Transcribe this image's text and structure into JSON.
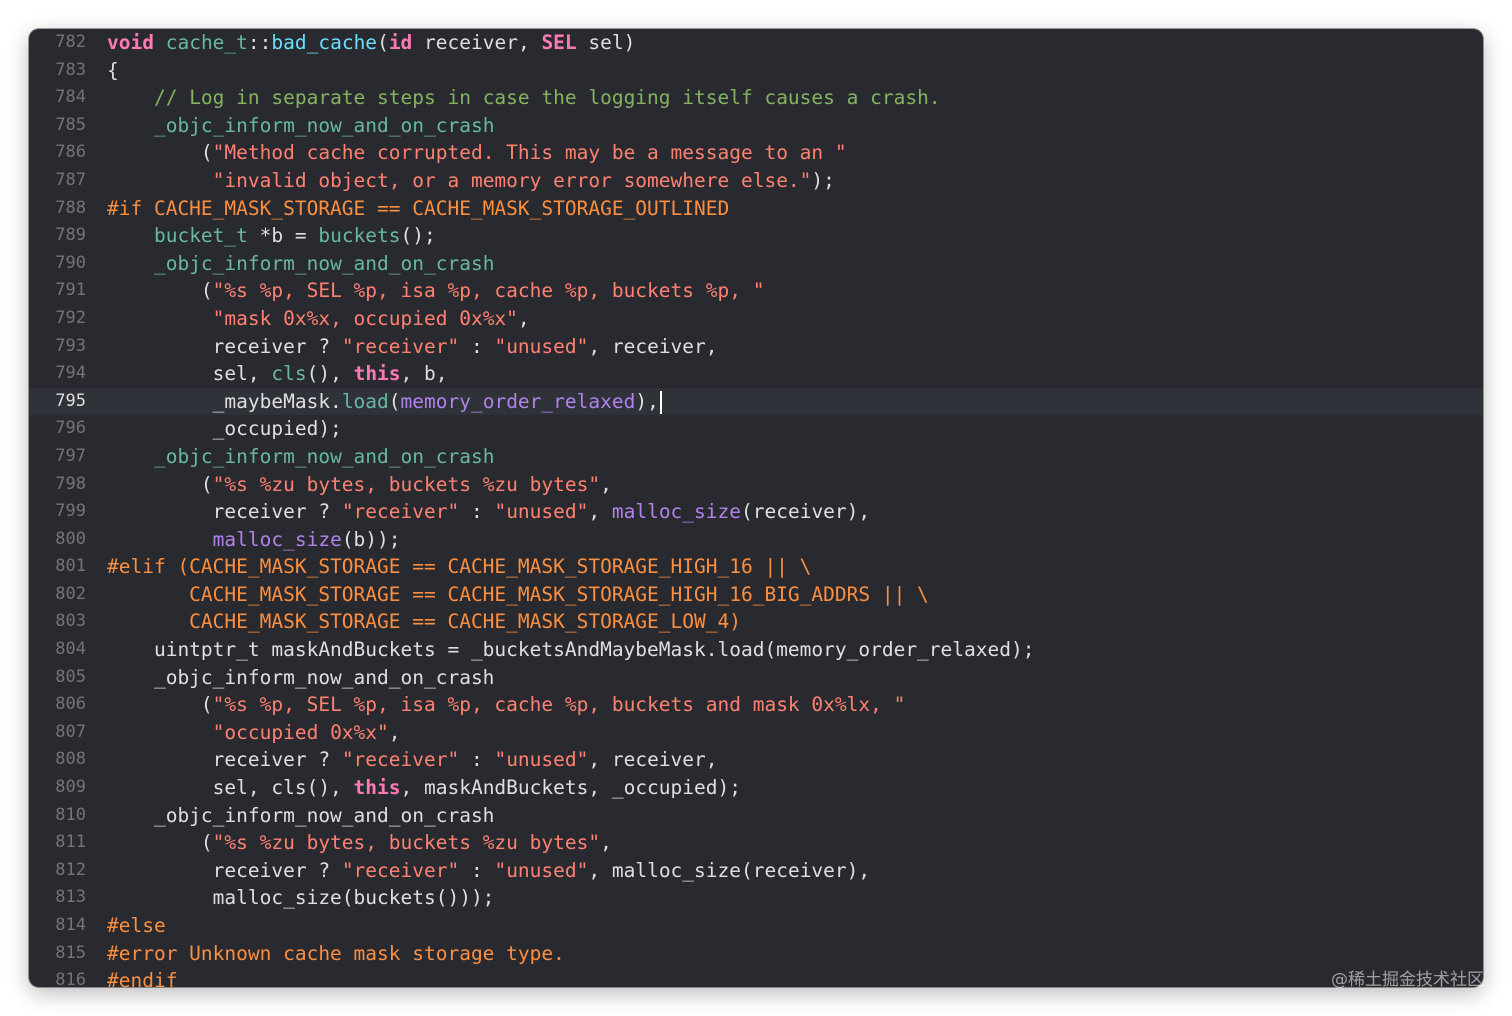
{
  "editor": {
    "current_line": "795",
    "lines": [
      {
        "no": "782",
        "tokens": [
          [
            "kw",
            "void"
          ],
          [
            "pl",
            " "
          ],
          [
            "fn",
            "cache_t"
          ],
          [
            "pl",
            "::"
          ],
          [
            "fn2",
            "bad_cache"
          ],
          [
            "pl",
            "("
          ],
          [
            "kw",
            "id"
          ],
          [
            "pl",
            " receiver, "
          ],
          [
            "kw",
            "SEL"
          ],
          [
            "pl",
            " sel)"
          ]
        ]
      },
      {
        "no": "783",
        "tokens": [
          [
            "pl",
            "{"
          ]
        ]
      },
      {
        "no": "784",
        "tokens": [
          [
            "pl",
            "    "
          ],
          [
            "cmt",
            "// Log in separate steps in case the logging itself causes a crash."
          ]
        ]
      },
      {
        "no": "785",
        "tokens": [
          [
            "pl",
            "    "
          ],
          [
            "fn",
            "_objc_inform_now_and_on_crash"
          ]
        ]
      },
      {
        "no": "786",
        "tokens": [
          [
            "pl",
            "        ("
          ],
          [
            "str",
            "\"Method cache corrupted. This may be a message to an \""
          ]
        ]
      },
      {
        "no": "787",
        "tokens": [
          [
            "pl",
            "         "
          ],
          [
            "str",
            "\"invalid object, or a memory error somewhere else.\""
          ],
          [
            "pl",
            ");"
          ]
        ]
      },
      {
        "no": "788",
        "tokens": [
          [
            "pp",
            "#if CACHE_MASK_STORAGE == CACHE_MASK_STORAGE_OUTLINED"
          ]
        ]
      },
      {
        "no": "789",
        "tokens": [
          [
            "pl",
            "    "
          ],
          [
            "fn",
            "bucket_t"
          ],
          [
            "pl",
            " *b = "
          ],
          [
            "fn",
            "buckets"
          ],
          [
            "pl",
            "();"
          ]
        ]
      },
      {
        "no": "790",
        "tokens": [
          [
            "pl",
            "    "
          ],
          [
            "fn",
            "_objc_inform_now_and_on_crash"
          ]
        ]
      },
      {
        "no": "791",
        "tokens": [
          [
            "pl",
            "        ("
          ],
          [
            "str",
            "\"%s %p, SEL %p, isa %p, cache %p, buckets %p, \""
          ]
        ]
      },
      {
        "no": "792",
        "tokens": [
          [
            "pl",
            "         "
          ],
          [
            "str",
            "\"mask 0x%x, occupied 0x%x\""
          ],
          [
            "pl",
            ","
          ]
        ]
      },
      {
        "no": "793",
        "tokens": [
          [
            "pl",
            "         receiver ? "
          ],
          [
            "str",
            "\"receiver\""
          ],
          [
            "pl",
            " : "
          ],
          [
            "str",
            "\"unused\""
          ],
          [
            "pl",
            ", receiver,"
          ]
        ]
      },
      {
        "no": "794",
        "tokens": [
          [
            "pl",
            "         sel, "
          ],
          [
            "fn",
            "cls"
          ],
          [
            "pl",
            "(), "
          ],
          [
            "kw",
            "this"
          ],
          [
            "pl",
            ", b,"
          ]
        ]
      },
      {
        "no": "795",
        "tokens": [
          [
            "pl",
            "         _maybeMask."
          ],
          [
            "fn",
            "load"
          ],
          [
            "pl",
            "("
          ],
          [
            "sys",
            "memory_order_relaxed"
          ],
          [
            "pl",
            "),"
          ]
        ]
      },
      {
        "no": "796",
        "tokens": [
          [
            "pl",
            "         _occupied);"
          ]
        ]
      },
      {
        "no": "797",
        "tokens": [
          [
            "pl",
            "    "
          ],
          [
            "fn",
            "_objc_inform_now_and_on_crash"
          ]
        ]
      },
      {
        "no": "798",
        "tokens": [
          [
            "pl",
            "        ("
          ],
          [
            "str",
            "\"%s %zu bytes, buckets %zu bytes\""
          ],
          [
            "pl",
            ","
          ]
        ]
      },
      {
        "no": "799",
        "tokens": [
          [
            "pl",
            "         receiver ? "
          ],
          [
            "str",
            "\"receiver\""
          ],
          [
            "pl",
            " : "
          ],
          [
            "str",
            "\"unused\""
          ],
          [
            "pl",
            ", "
          ],
          [
            "sys",
            "malloc_size"
          ],
          [
            "pl",
            "(receiver),"
          ]
        ]
      },
      {
        "no": "800",
        "tokens": [
          [
            "pl",
            "         "
          ],
          [
            "sys",
            "malloc_size"
          ],
          [
            "pl",
            "(b));"
          ]
        ]
      },
      {
        "no": "801",
        "tokens": [
          [
            "pp",
            "#elif (CACHE_MASK_STORAGE == CACHE_MASK_STORAGE_HIGH_16 || \\"
          ]
        ]
      },
      {
        "no": "802",
        "tokens": [
          [
            "pp",
            "       CACHE_MASK_STORAGE == CACHE_MASK_STORAGE_HIGH_16_BIG_ADDRS || \\"
          ]
        ]
      },
      {
        "no": "803",
        "tokens": [
          [
            "pp",
            "       CACHE_MASK_STORAGE == CACHE_MASK_STORAGE_LOW_4)"
          ]
        ]
      },
      {
        "no": "804",
        "tokens": [
          [
            "pl",
            "    uintptr_t maskAndBuckets = _bucketsAndMaybeMask.load(memory_order_relaxed);"
          ]
        ]
      },
      {
        "no": "805",
        "tokens": [
          [
            "pl",
            "    _objc_inform_now_and_on_crash"
          ]
        ]
      },
      {
        "no": "806",
        "tokens": [
          [
            "pl",
            "        ("
          ],
          [
            "str",
            "\"%s %p, SEL %p, isa %p, cache %p, buckets and mask 0x%lx, \""
          ]
        ]
      },
      {
        "no": "807",
        "tokens": [
          [
            "pl",
            "         "
          ],
          [
            "str",
            "\"occupied 0x%x\""
          ],
          [
            "pl",
            ","
          ]
        ]
      },
      {
        "no": "808",
        "tokens": [
          [
            "pl",
            "         receiver ? "
          ],
          [
            "str",
            "\"receiver\""
          ],
          [
            "pl",
            " : "
          ],
          [
            "str",
            "\"unused\""
          ],
          [
            "pl",
            ", receiver,"
          ]
        ]
      },
      {
        "no": "809",
        "tokens": [
          [
            "pl",
            "         sel, cls(), "
          ],
          [
            "kw",
            "this"
          ],
          [
            "pl",
            ", maskAndBuckets, _occupied);"
          ]
        ]
      },
      {
        "no": "810",
        "tokens": [
          [
            "pl",
            "    _objc_inform_now_and_on_crash"
          ]
        ]
      },
      {
        "no": "811",
        "tokens": [
          [
            "pl",
            "        ("
          ],
          [
            "str",
            "\"%s %zu bytes, buckets %zu bytes\""
          ],
          [
            "pl",
            ","
          ]
        ]
      },
      {
        "no": "812",
        "tokens": [
          [
            "pl",
            "         receiver ? "
          ],
          [
            "str",
            "\"receiver\""
          ],
          [
            "pl",
            " : "
          ],
          [
            "str",
            "\"unused\""
          ],
          [
            "pl",
            ", malloc_size(receiver),"
          ]
        ]
      },
      {
        "no": "813",
        "tokens": [
          [
            "pl",
            "         malloc_size(buckets()));"
          ]
        ]
      },
      {
        "no": "814",
        "tokens": [
          [
            "pp",
            "#else"
          ]
        ]
      },
      {
        "no": "815",
        "tokens": [
          [
            "pp",
            "#error Unknown cache mask storage type."
          ]
        ]
      },
      {
        "no": "816",
        "tokens": [
          [
            "pp",
            "#endif"
          ]
        ]
      }
    ]
  },
  "watermark": "@稀土掘金技术社区",
  "colors": {
    "background": "#292a30",
    "current_line_background": "#2f3239",
    "keyword": "#ff7ab2",
    "string": "#ff8170",
    "comment": "#84b360",
    "preprocessor": "#fd8f3f",
    "project_identifier": "#67b7a4",
    "declaration": "#6bdfff",
    "system_identifier": "#b281eb",
    "plain_text": "#dfdfe0",
    "line_number": "#747478"
  }
}
